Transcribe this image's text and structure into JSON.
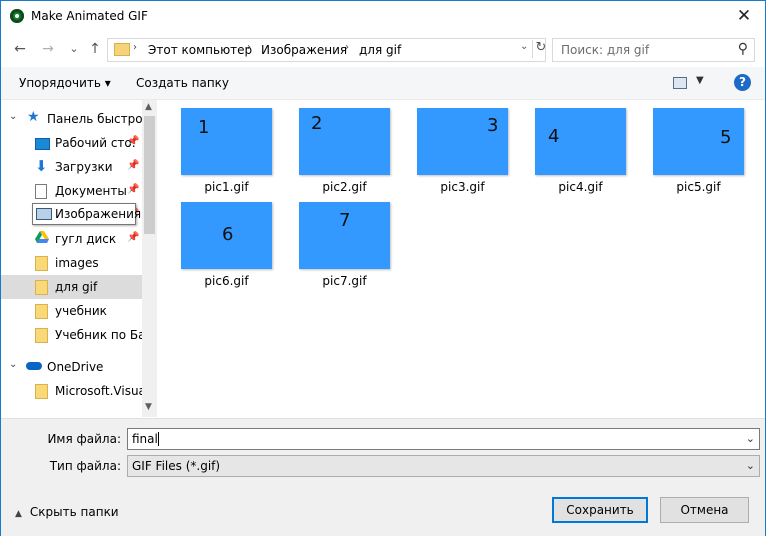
{
  "window": {
    "title": "Make Animated GIF",
    "close_glyph": "✕"
  },
  "nav": {
    "back": "←",
    "forward": "→",
    "recent": "⌄",
    "up": "↑"
  },
  "breadcrumbs": [
    "Этот компьютер",
    "Изображения",
    "для gif"
  ],
  "search": {
    "placeholder": "Поиск: для gif"
  },
  "toolbar": {
    "organize_label": "Упорядочить ▾",
    "new_folder_label": "Создать папку",
    "help_label": "?"
  },
  "sidebar": {
    "items": [
      {
        "label": "Панель быстрого доступа",
        "icon": "star-icon",
        "pinned": false
      },
      {
        "label": "Рабочий сто.",
        "icon": "desktop-icon",
        "pinned": true
      },
      {
        "label": "Загрузки",
        "icon": "download-icon",
        "pinned": true
      },
      {
        "label": "Документы",
        "icon": "document-icon",
        "pinned": true
      },
      {
        "label": "Изображения",
        "icon": "pictures-icon",
        "pinned": true
      },
      {
        "label": "гугл диск",
        "icon": "google-drive-icon",
        "pinned": true
      },
      {
        "label": "images",
        "icon": "folder-icon",
        "pinned": false
      },
      {
        "label": "для gif",
        "icon": "folder-icon",
        "pinned": false
      },
      {
        "label": "учебник",
        "icon": "folder-icon",
        "pinned": false
      },
      {
        "label": "Учебник по Баз",
        "icon": "folder-icon",
        "pinned": false
      },
      {
        "label": "OneDrive",
        "icon": "onedrive-icon",
        "pinned": false
      },
      {
        "label": "Microsoft.Visual",
        "icon": "folder-icon",
        "pinned": false
      }
    ],
    "tooltip": "Изображения",
    "selected": "для gif"
  },
  "files": [
    {
      "name": "pic1.gif",
      "label": "1"
    },
    {
      "name": "pic2.gif",
      "label": "2"
    },
    {
      "name": "pic3.gif",
      "label": "3"
    },
    {
      "name": "pic4.gif",
      "label": "4"
    },
    {
      "name": "pic5.gif",
      "label": "5"
    },
    {
      "name": "pic6.gif",
      "label": "6"
    },
    {
      "name": "pic7.gif",
      "label": "7"
    }
  ],
  "form": {
    "filename_label": "Имя файла:",
    "filename_value": "final",
    "filetype_label": "Тип файла:",
    "filetype_value": "GIF Files (*.gif)",
    "hide_folders_label": "Скрыть папки",
    "save_label": "Сохранить",
    "cancel_label": "Отмена"
  },
  "colors": {
    "thumbnail": "#3399ff",
    "accent": "#0078d7"
  }
}
